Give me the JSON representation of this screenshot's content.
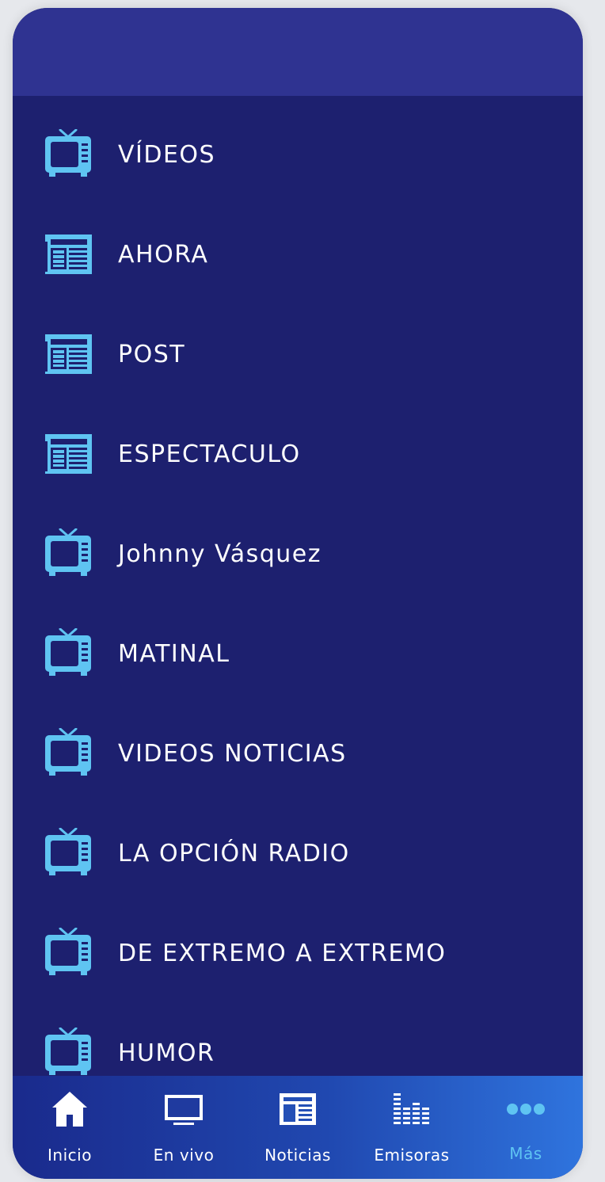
{
  "menu": {
    "items": [
      {
        "label": "VÍDEOS",
        "icon": "tv-icon"
      },
      {
        "label": "AHORA",
        "icon": "newspaper-icon"
      },
      {
        "label": "POST",
        "icon": "newspaper-icon"
      },
      {
        "label": "ESPECTACULO",
        "icon": "newspaper-icon"
      },
      {
        "label": "Johnny Vásquez",
        "icon": "tv-icon"
      },
      {
        "label": "MATINAL",
        "icon": "tv-icon"
      },
      {
        "label": "VIDEOS NOTICIAS",
        "icon": "tv-icon"
      },
      {
        "label": "LA OPCIÓN RADIO",
        "icon": "tv-icon"
      },
      {
        "label": "DE EXTREMO A EXTREMO",
        "icon": "tv-icon"
      },
      {
        "label": "HUMOR",
        "icon": "tv-icon"
      }
    ]
  },
  "tabbar": {
    "tabs": [
      {
        "label": "Inicio",
        "icon": "home-icon"
      },
      {
        "label": "En vivo",
        "icon": "monitor-icon"
      },
      {
        "label": "Noticias",
        "icon": "newspaper-icon"
      },
      {
        "label": "Emisoras",
        "icon": "equalizer-icon"
      },
      {
        "label": "Más",
        "icon": "more-dots-icon",
        "active": true
      }
    ]
  },
  "colors": {
    "header": "#2f3391",
    "menu_background": "#1d206f",
    "icon_accent": "#5fc4f2",
    "text": "#ffffff",
    "tab_active": "#5fc4f2"
  }
}
